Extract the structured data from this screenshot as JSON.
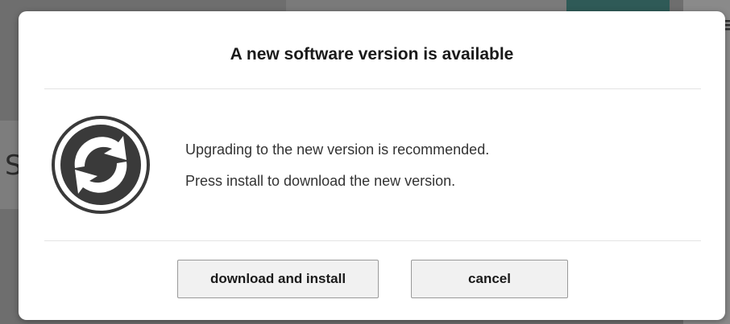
{
  "background": {
    "partial_letter_left": "S",
    "partial_glyph_right": "≡"
  },
  "dialog": {
    "title": "A new software version is available",
    "icon": "sync-arrows-icon",
    "message_line_1": "Upgrading to the new version is recommended.",
    "message_line_2": "Press install to download the new version.",
    "buttons": {
      "install_label": "download and install",
      "cancel_label": "cancel"
    }
  },
  "colors": {
    "backdrop": "#6e6e6e",
    "dialog_background": "#ffffff",
    "icon_dark": "#3a3a3a",
    "button_background": "#f1f1f1",
    "button_border": "#9a9a9a",
    "teal_tab": "#2f5a57"
  }
}
